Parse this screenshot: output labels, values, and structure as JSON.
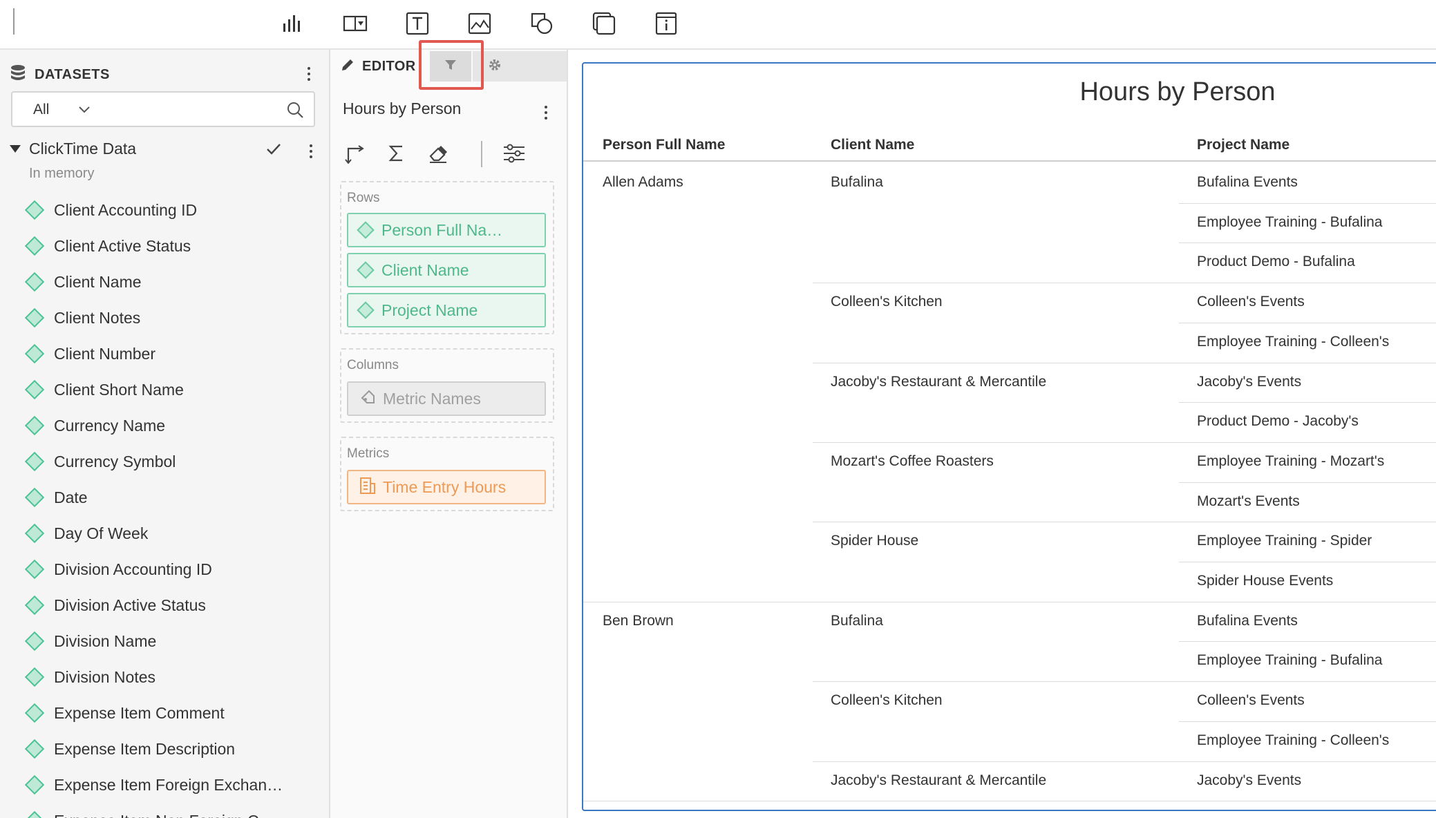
{
  "toolbar": {
    "icons": [
      "bar-chart-icon",
      "select-panel-icon",
      "text-icon",
      "image-icon",
      "shapes-icon",
      "layers-icon",
      "info-box-icon"
    ]
  },
  "datasets": {
    "title": "DATASETS",
    "filter_value": "All",
    "source": {
      "name": "ClickTime Data",
      "status": "In memory"
    },
    "fields": [
      "Client Accounting ID",
      "Client Active Status",
      "Client Name",
      "Client Notes",
      "Client Number",
      "Client Short Name",
      "Currency Name",
      "Currency Symbol",
      "Date",
      "Day Of Week",
      "Division Accounting ID",
      "Division Active Status",
      "Division Name",
      "Division Notes",
      "Expense Item Comment",
      "Expense Item Description",
      "Expense Item Foreign Exchan…",
      "Expense Item Non Foreign C…"
    ]
  },
  "editor": {
    "tab_label": "EDITOR",
    "chart_title": "Hours by Person",
    "rows_label": "Rows",
    "rows": [
      "Person Full Na…",
      "Client Name",
      "Project Name"
    ],
    "columns_label": "Columns",
    "columns": [
      "Metric Names"
    ],
    "metrics_label": "Metrics",
    "metrics": [
      "Time Entry Hours"
    ]
  },
  "report": {
    "title": "Hours by Person",
    "headers": [
      "Person Full Name",
      "Client Name",
      "Project Name"
    ],
    "persons": [
      {
        "name": "Allen Adams",
        "clients": [
          {
            "name": "Bufalina",
            "projects": [
              "Bufalina Events",
              "Employee Training - Bufalina",
              "Product Demo - Bufalina"
            ]
          },
          {
            "name": "Colleen's Kitchen",
            "projects": [
              "Colleen's Events",
              "Employee Training - Colleen's"
            ]
          },
          {
            "name": "Jacoby's Restaurant & Mercantile",
            "projects": [
              "Jacoby's Events",
              "Product Demo - Jacoby's"
            ]
          },
          {
            "name": "Mozart's Coffee Roasters",
            "projects": [
              "Employee Training - Mozart's",
              "Mozart's Events"
            ]
          },
          {
            "name": "Spider House",
            "projects": [
              "Employee Training - Spider",
              "Spider House Events"
            ]
          }
        ]
      },
      {
        "name": "Ben Brown",
        "clients": [
          {
            "name": "Bufalina",
            "projects": [
              "Bufalina Events",
              "Employee Training - Bufalina"
            ]
          },
          {
            "name": "Colleen's Kitchen",
            "projects": [
              "Colleen's Events",
              "Employee Training - Colleen's"
            ]
          },
          {
            "name": "Jacoby's Restaurant & Mercantile",
            "projects": [
              "Jacoby's Events"
            ]
          }
        ]
      }
    ]
  },
  "colors": {
    "accent": "#3b78c4",
    "dimension": "#4fb88a",
    "metric": "#ec9a55",
    "highlight": "#e0584f"
  }
}
